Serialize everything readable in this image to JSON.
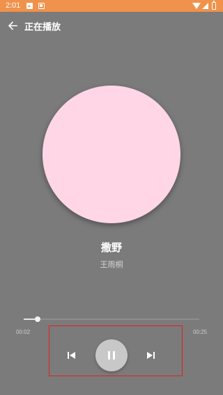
{
  "status_bar": {
    "time": "2:01",
    "icons": [
      "image-icon",
      "notification-icon",
      "wifi-icon",
      "signal-icon",
      "battery-icon"
    ]
  },
  "app_bar": {
    "back_icon": "arrow-back-icon",
    "title": "正在播放"
  },
  "now_playing": {
    "album_art_color": "#ffd6e6",
    "song_title": "撒野",
    "artist": "王雨桐"
  },
  "progress": {
    "current_time": "00:02",
    "total_time": "00:25",
    "fraction": 0.08
  },
  "controls": {
    "previous_icon": "skip-previous-icon",
    "play_pause_icon": "pause-icon",
    "next_icon": "skip-next-icon"
  },
  "colors": {
    "status_bar": "#f0924b",
    "background": "#7b7b7b",
    "highlight_box": "#e02020"
  }
}
